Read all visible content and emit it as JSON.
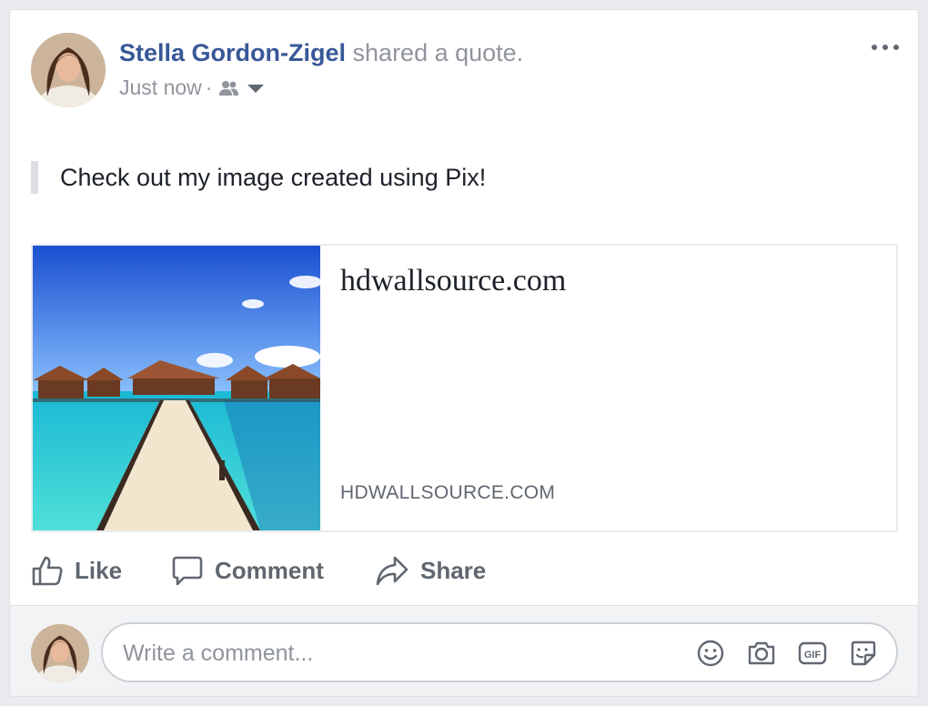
{
  "post": {
    "author": "Stella Gordon-Zigel",
    "action": "shared a quote.",
    "timestamp": "Just now",
    "separator": "·",
    "audience_icon": "friends-icon",
    "quote": "Check out my image created using Pix!"
  },
  "link": {
    "title": "hdwallsource.com",
    "domain": "HDWALLSOURCE.COM"
  },
  "actions": {
    "like_label": "Like",
    "comment_label": "Comment",
    "share_label": "Share"
  },
  "comment": {
    "placeholder": "Write a comment...",
    "icons": [
      "emoji-icon",
      "camera-icon",
      "gif-icon",
      "sticker-icon"
    ]
  },
  "colors": {
    "author": "#385898",
    "muted": "#90949c",
    "action": "#606770",
    "background": "#e9ebee"
  }
}
